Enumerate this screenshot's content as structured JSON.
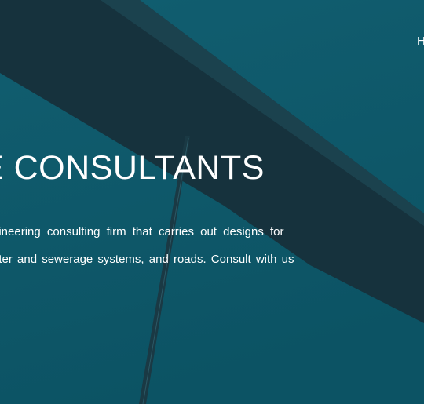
{
  "nav": {
    "home_label": "H"
  },
  "hero": {
    "title": "E CONSULTANTS",
    "description_lines": [
      "gineering  consulting  firm  that  carries  out  designs  for",
      "nter  and  sewerage  systems,  and  roads.  Consult  with  us"
    ]
  },
  "colors": {
    "background": "#0f5a6b",
    "beam_dark": "#16323d",
    "text": "#ffffff"
  }
}
